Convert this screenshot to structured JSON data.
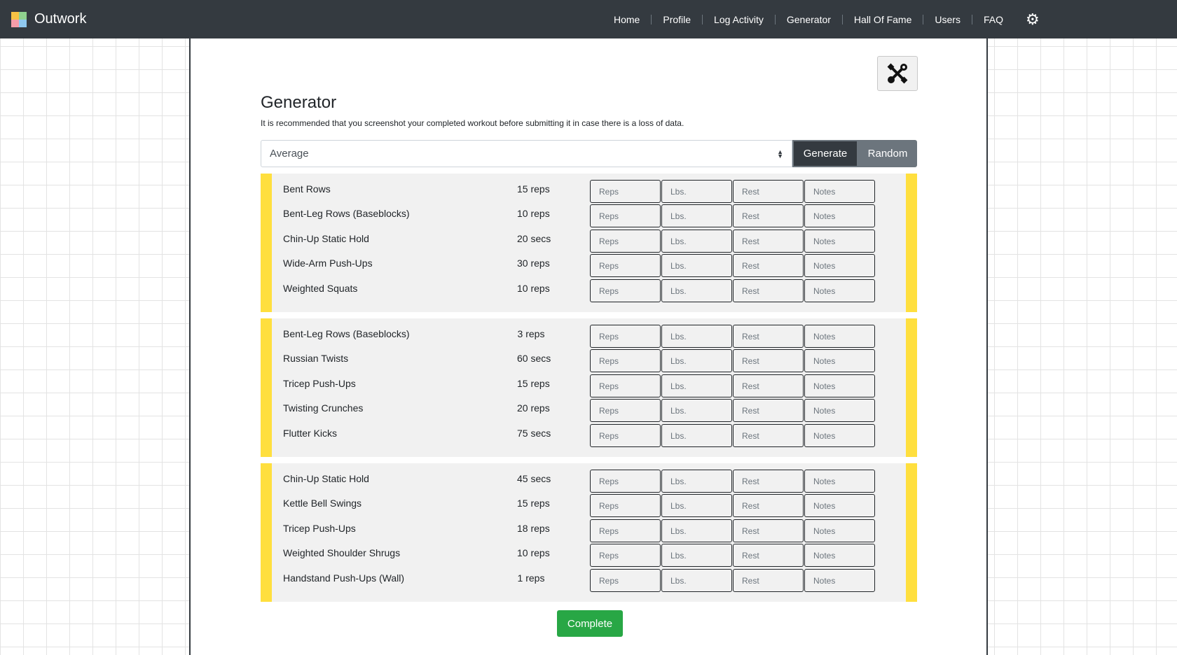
{
  "nav": {
    "brand": "Outwork",
    "logo_colors": [
      "#f6c244",
      "#8fd18e",
      "#f59ca9",
      "#8fc9f0"
    ],
    "links": [
      "Home",
      "Profile",
      "Log Activity",
      "Generator",
      "Hall Of Fame",
      "Users",
      "FAQ"
    ],
    "settings_icon": "gear-icon"
  },
  "page": {
    "tools_icon": "wrench-screwdriver-icon",
    "title": "Generator",
    "note": "It is recommended that you screenshot your completed workout before submitting it in case there is a loss of data.",
    "difficulty_select": "Average",
    "generate_label": "Generate",
    "random_label": "Random",
    "complete_label": "Complete"
  },
  "placeholders": {
    "reps": "Reps",
    "lbs": "Lbs.",
    "rest": "Rest",
    "notes": "Notes"
  },
  "circuits": [
    {
      "exercises": [
        {
          "name": "Bent Rows",
          "amount": "15 reps"
        },
        {
          "name": "Bent-Leg Rows (Baseblocks)",
          "amount": "10 reps"
        },
        {
          "name": "Chin-Up Static Hold",
          "amount": "20 secs"
        },
        {
          "name": "Wide-Arm Push-Ups",
          "amount": "30 reps"
        },
        {
          "name": "Weighted Squats",
          "amount": "10 reps"
        }
      ]
    },
    {
      "exercises": [
        {
          "name": "Bent-Leg Rows (Baseblocks)",
          "amount": "3 reps"
        },
        {
          "name": "Russian Twists",
          "amount": "60 secs"
        },
        {
          "name": "Tricep Push-Ups",
          "amount": "15 reps"
        },
        {
          "name": "Twisting Crunches",
          "amount": "20 reps"
        },
        {
          "name": "Flutter Kicks",
          "amount": "75 secs"
        }
      ]
    },
    {
      "exercises": [
        {
          "name": "Chin-Up Static Hold",
          "amount": "45 secs"
        },
        {
          "name": "Kettle Bell Swings",
          "amount": "15 reps"
        },
        {
          "name": "Tricep Push-Ups",
          "amount": "18 reps"
        },
        {
          "name": "Weighted Shoulder Shrugs",
          "amount": "10 reps"
        },
        {
          "name": "Handstand Push-Ups (Wall)",
          "amount": "1 reps"
        }
      ]
    }
  ],
  "colors": {
    "navbar": "#343a40",
    "circuit_accent": "#ffdf3e",
    "complete_button": "#28a745",
    "random_button": "#6c757d"
  }
}
